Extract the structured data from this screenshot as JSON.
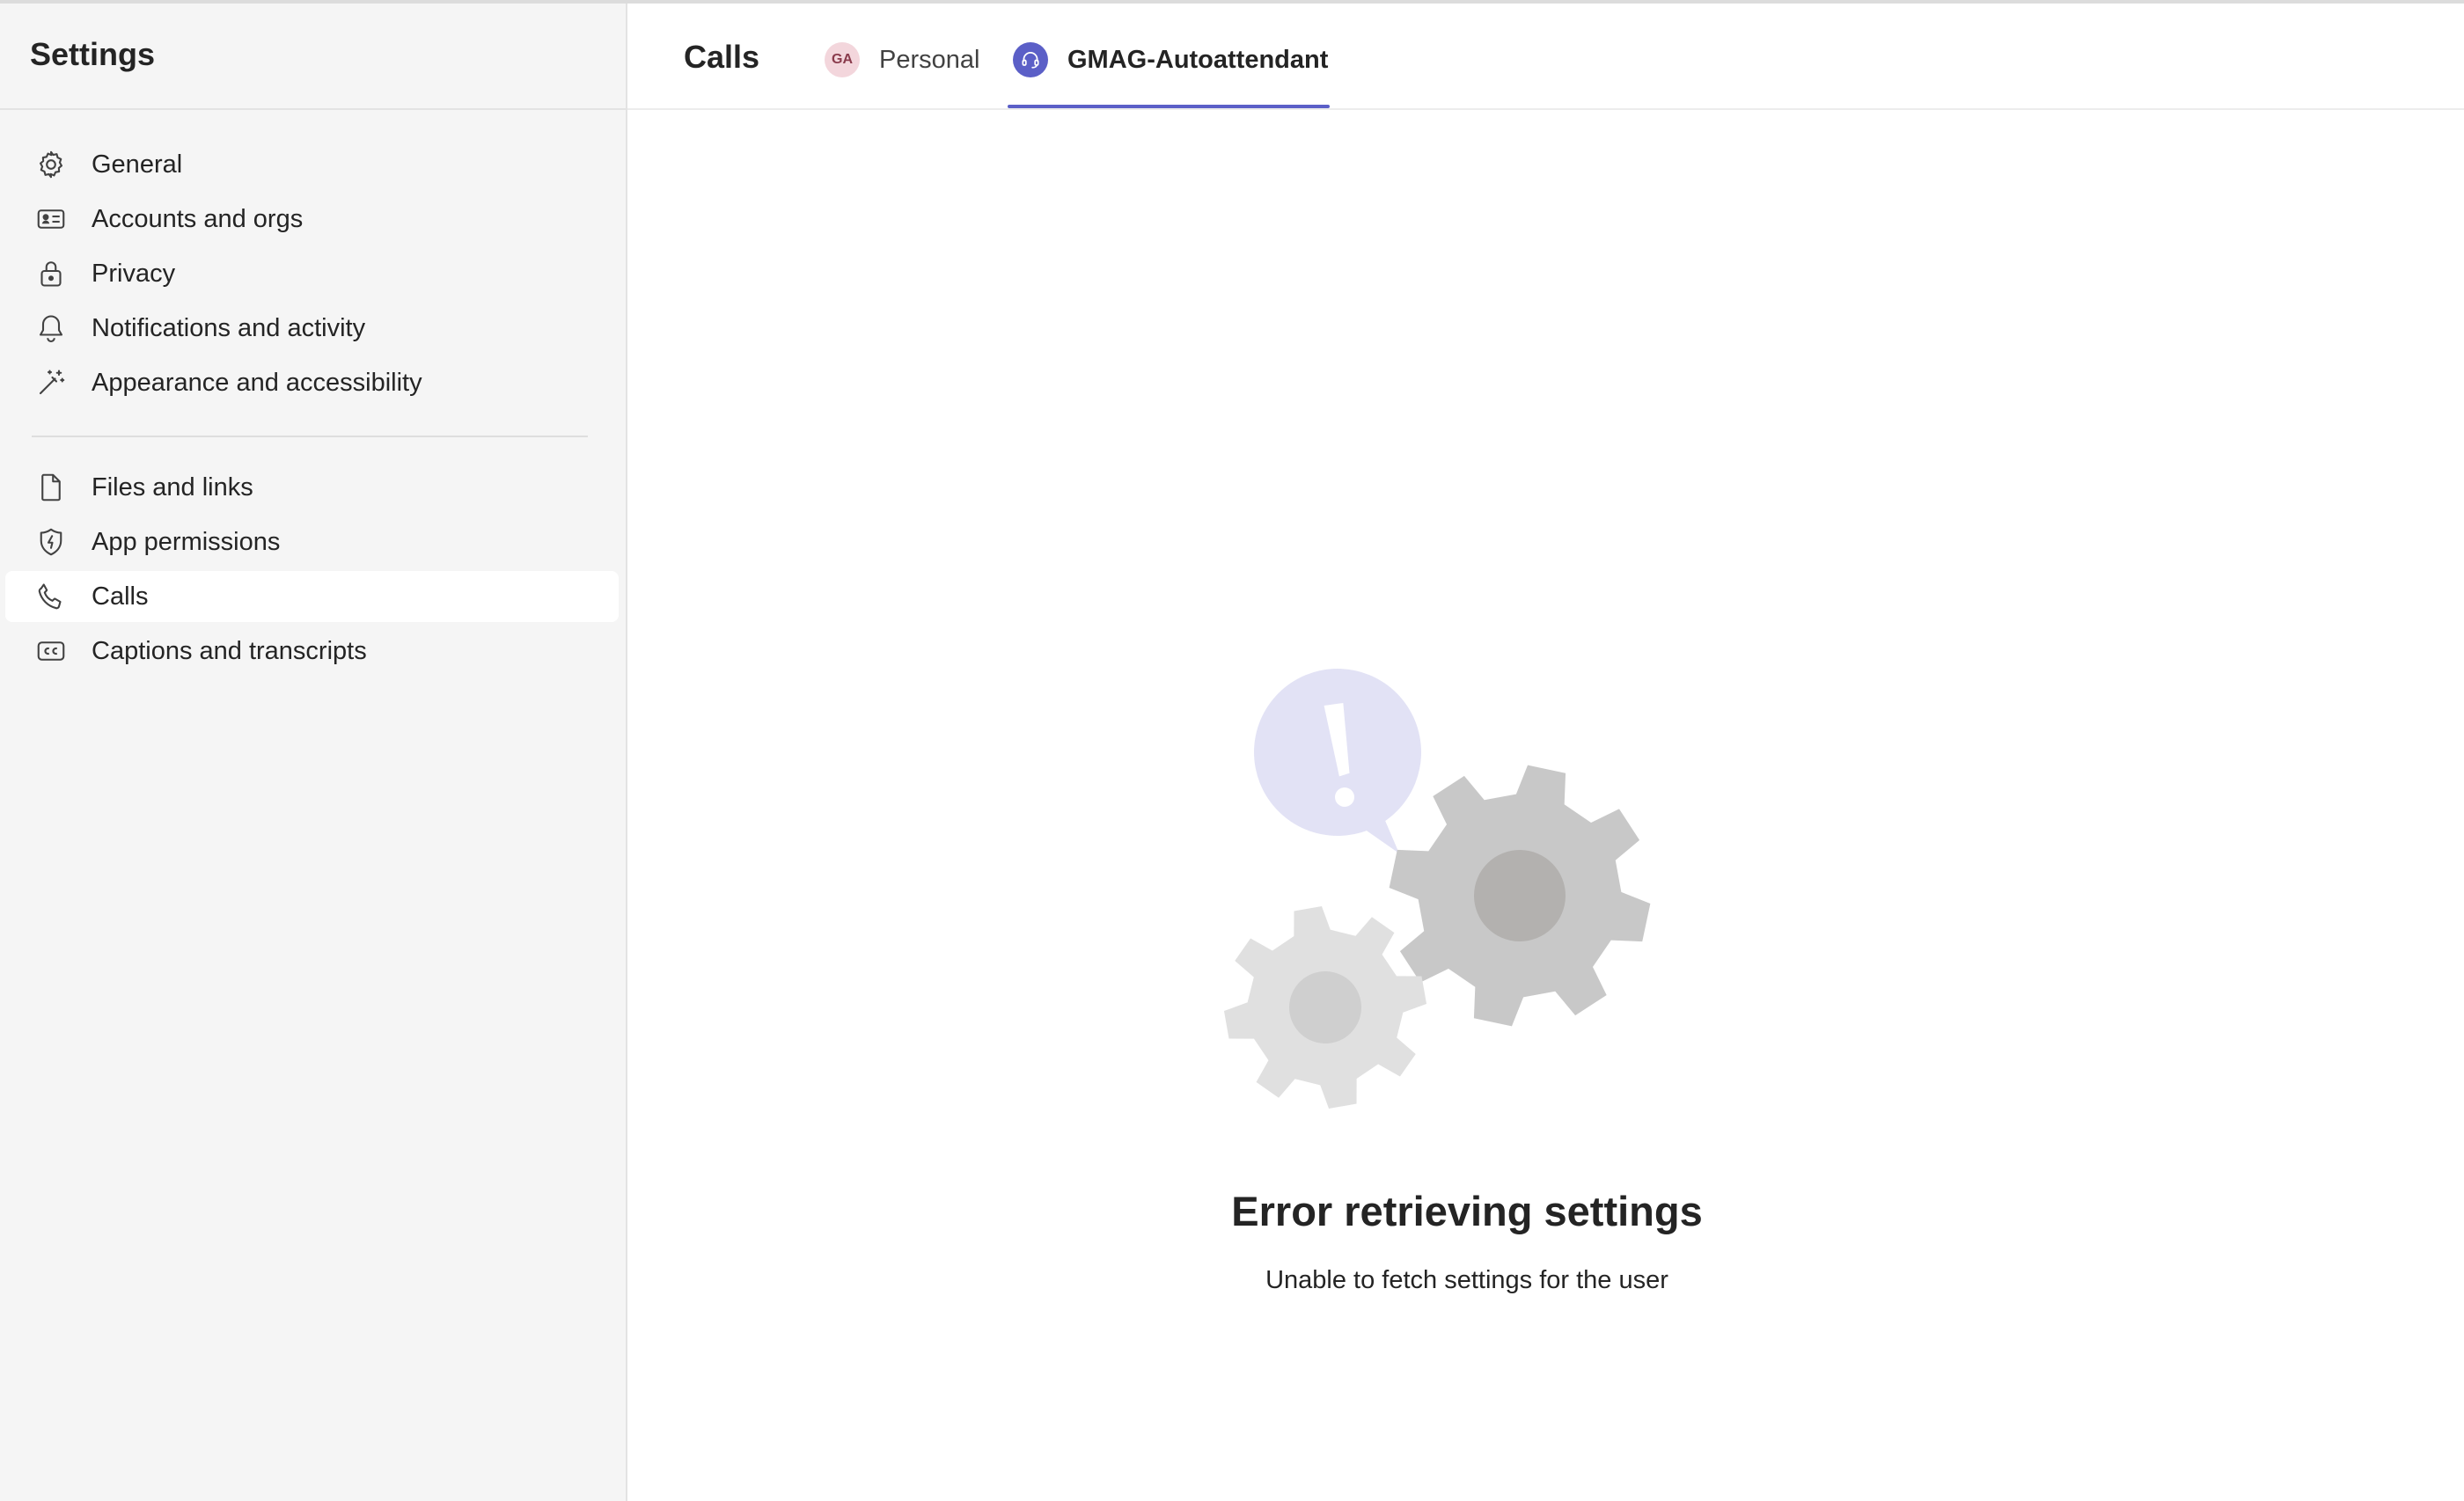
{
  "sidebar": {
    "title": "Settings",
    "groups": [
      [
        {
          "label": "General",
          "icon": "gear-icon"
        },
        {
          "label": "Accounts and orgs",
          "icon": "id-card-icon"
        },
        {
          "label": "Privacy",
          "icon": "lock-icon"
        },
        {
          "label": "Notifications and activity",
          "icon": "bell-icon"
        },
        {
          "label": "Appearance and accessibility",
          "icon": "magic-wand-icon"
        }
      ],
      [
        {
          "label": "Files and links",
          "icon": "document-icon"
        },
        {
          "label": "App permissions",
          "icon": "shield-icon"
        },
        {
          "label": "Calls",
          "icon": "phone-icon",
          "active": true
        },
        {
          "label": "Captions and transcripts",
          "icon": "closed-captions-icon"
        }
      ]
    ]
  },
  "main": {
    "title": "Calls",
    "tabs": [
      {
        "label": "Personal",
        "avatar_initials": "GA",
        "selected": false
      },
      {
        "label": "GMAG-Autoattendant",
        "icon": "headset-icon",
        "selected": true
      }
    ],
    "error": {
      "title": "Error retrieving settings",
      "message": "Unable to fetch settings for the user"
    }
  },
  "colors": {
    "accent": "#5b5fc7",
    "sidebar_bg": "#f5f5f5",
    "bubble": "#e2e2f5",
    "gear_dark": "#c8c8c8",
    "gear_light": "#e0e0e0"
  }
}
